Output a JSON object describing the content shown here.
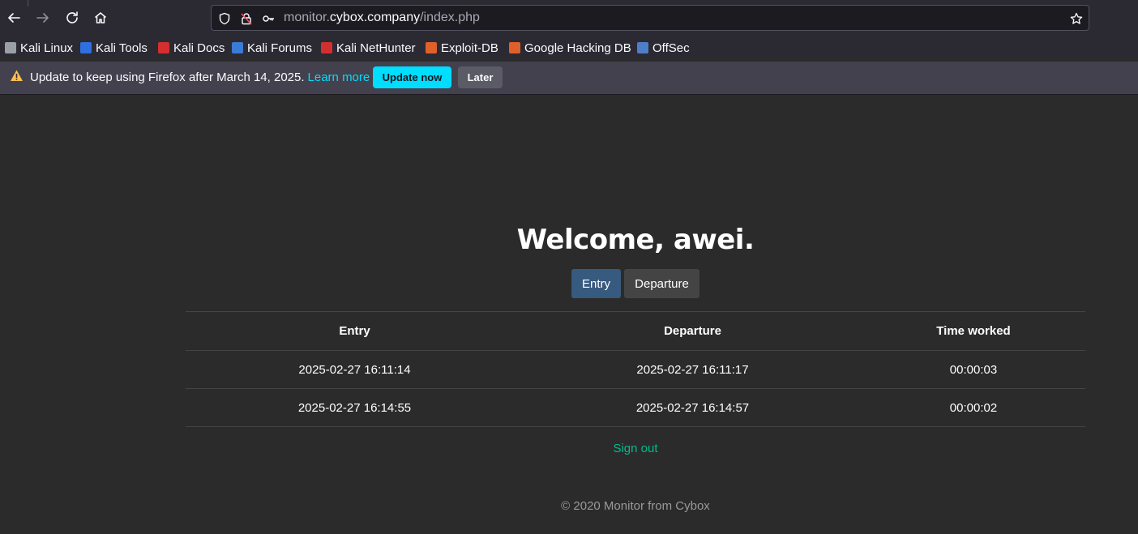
{
  "browser": {
    "url": {
      "prefix": "monitor.",
      "domain": "cybox.company",
      "path": "/index.php"
    },
    "bookmarks": [
      {
        "label": "Kali Linux",
        "color": "#9aa0a6"
      },
      {
        "label": "Kali Tools",
        "color": "#2f6fdf"
      },
      {
        "label": "Kali Docs",
        "color": "#d32f2f"
      },
      {
        "label": "Kali Forums",
        "color": "#3a7bd5"
      },
      {
        "label": "Kali NetHunter",
        "color": "#d32f2f"
      },
      {
        "label": "Exploit-DB",
        "color": "#e0602b"
      },
      {
        "label": "Google Hacking DB",
        "color": "#e0602b"
      },
      {
        "label": "OffSec",
        "color": "#4f7ec9"
      }
    ],
    "notice": {
      "text": "Update to keep using Firefox after March 14, 2025.",
      "link": "Learn more",
      "update_label": "Update now",
      "later_label": "Later"
    }
  },
  "page": {
    "welcome_prefix": "Welcome, ",
    "username": "awei",
    "welcome_suffix": ".",
    "entry_button": "Entry",
    "departure_button": "Departure",
    "table": {
      "headers": [
        "Entry",
        "Departure",
        "Time worked"
      ],
      "rows": [
        [
          "2025-02-27 16:11:14",
          "2025-02-27 16:11:17",
          "00:00:03"
        ],
        [
          "2025-02-27 16:14:55",
          "2025-02-27 16:14:57",
          "00:00:02"
        ]
      ]
    },
    "signout": "Sign out",
    "footer": "© 2020 Monitor from Cybox"
  },
  "colors": {
    "accent": "#00ddff",
    "primary_button": "#375a7f",
    "link_green": "#00bc8c"
  }
}
